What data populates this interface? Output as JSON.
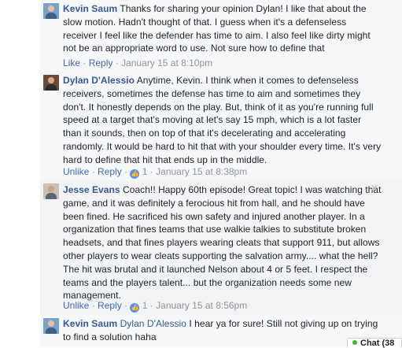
{
  "comments": [
    {
      "author": "Kevin Saum",
      "mention": "",
      "text": "Thanks for sharing your opinion Dylan! I like that about the slow motion. Hadn't thought of that. I guess when it's a defenseless receiver I feel like the defender has time to aim. I also feel like dirty might not be an appropriate word to use. Not sure how to define that",
      "like_label": "Like",
      "reply_label": "Reply",
      "timestamp": "January 15 at 8:10pm",
      "reaction_count": ""
    },
    {
      "author": "Dylan D'Alessio",
      "mention": "",
      "text": "Anytime, Kevin. I think when it comes to defenseless receivers, sometimes the defense has time to aim and sometimes they don't. It honestly depends on the play. But, think of it as you're running full speed at a target that's moving at let's say 15 mph, which is a lot faster than it sounds, then on top of that it's decelerating and accelerating randomly. It would be hard to hit that with your shoulder every time. It's very hard to define that hit that ends up in the middle.",
      "like_label": "Unlike",
      "reply_label": "Reply",
      "timestamp": "January 15 at 8:38pm",
      "reaction_count": "1"
    },
    {
      "author": "Jesse Evans",
      "mention": "",
      "text": "Coach!! Happy 60th episode! Great topic! I was watching that game, and it was definitely a ferocious hit from hall, and he should have been fined. He sacrificed his own safety and injured another player. In a organization that fines teams that use walkie talkies to substitute broken headsets, and that fines players wearing cleats that support 911, but allows other players to wear cleats supporting the salvation army.... what the hell? The hit was brutal and it launched Nelson about 4 or 5 feet. I respect the teams and the players talent... but the organization needs some new management.",
      "like_label": "Unlike",
      "reply_label": "Reply",
      "timestamp": "January 15 at 8:56pm",
      "reaction_count": "1"
    },
    {
      "author": "Kevin Saum",
      "mention": "Dylan D'Alessio",
      "text": "I hear ya for sure! Still not giving up on trying to find a solution haha",
      "like_label": "",
      "reply_label": "",
      "timestamp": "",
      "reaction_count": ""
    }
  ],
  "chat": {
    "label": "Chat (38"
  },
  "icons": {
    "close": "close-icon",
    "reaction": "like-reaction-icon"
  },
  "colors": {
    "link": "#365899",
    "action_link": "#4267b2",
    "meta": "#90949c",
    "like_badge": "#5890ff",
    "online": "#42b72a"
  }
}
